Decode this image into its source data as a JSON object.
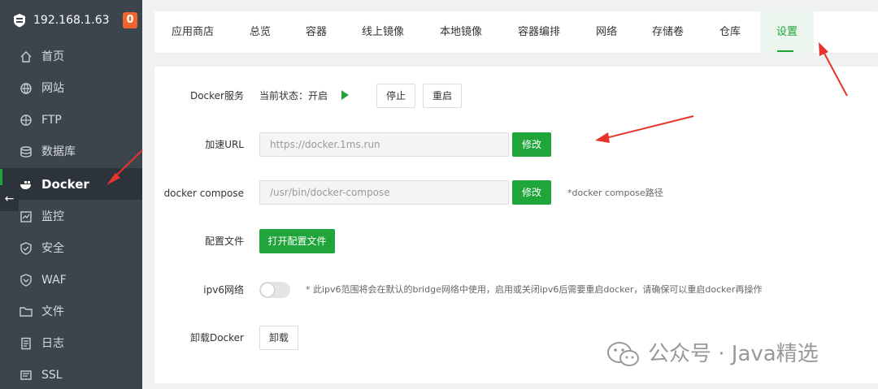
{
  "sidebar": {
    "host": "192.168.1.63",
    "badge": "0",
    "items": [
      {
        "label": "首页",
        "icon": "home-icon"
      },
      {
        "label": "网站",
        "icon": "globe-icon"
      },
      {
        "label": "FTP",
        "icon": "ftp-icon"
      },
      {
        "label": "数据库",
        "icon": "database-icon"
      },
      {
        "label": "Docker",
        "icon": "docker-icon"
      },
      {
        "label": "监控",
        "icon": "monitor-icon"
      },
      {
        "label": "安全",
        "icon": "shield-icon"
      },
      {
        "label": "WAF",
        "icon": "waf-shield-icon"
      },
      {
        "label": "文件",
        "icon": "folder-icon"
      },
      {
        "label": "日志",
        "icon": "log-icon"
      },
      {
        "label": "SSL",
        "icon": "ssl-icon"
      }
    ],
    "active": "Docker",
    "collapse_glyph": "←"
  },
  "tabs": [
    "应用商店",
    "总览",
    "容器",
    "线上镜像",
    "本地镜像",
    "容器编排",
    "网络",
    "存储卷",
    "仓库",
    "设置"
  ],
  "active_tab": "设置",
  "settings": {
    "docker_service": {
      "label": "Docker服务",
      "status": "当前状态：开启",
      "stop_btn": "停止",
      "restart_btn": "重启"
    },
    "mirror_url": {
      "label": "加速URL",
      "value": "https://docker.1ms.run",
      "btn": "修改"
    },
    "compose": {
      "label": "docker compose",
      "value": "/usr/bin/docker-compose",
      "btn": "修改",
      "hint": "*docker compose路径"
    },
    "config_file": {
      "label": "配置文件",
      "btn": "打开配置文件"
    },
    "ipv6": {
      "label": "ipv6网络",
      "enabled": false,
      "hint": "* 此ipv6范围将会在默认的bridge网络中使用，启用或关闭ipv6后需要重启docker，请确保可以重启docker再操作"
    },
    "uninstall": {
      "label": "卸载Docker",
      "btn": "卸载"
    }
  },
  "watermark": "公众号 · Java精选",
  "colors": {
    "accent": "#20a53a",
    "sidebar": "#3c444d",
    "badge": "#f0642e",
    "annotation": "#e8332a"
  }
}
